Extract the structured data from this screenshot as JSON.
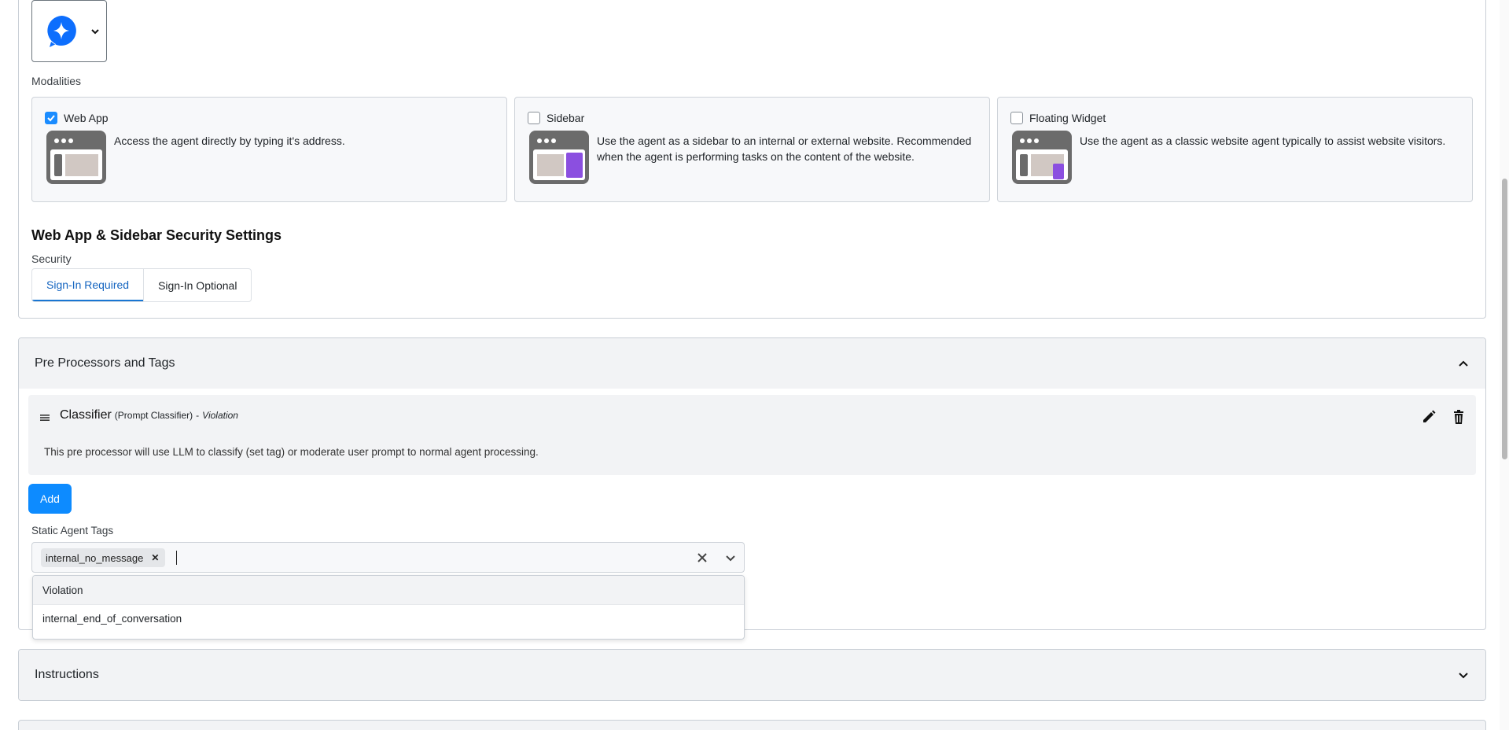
{
  "modalities": {
    "label": "Modalities",
    "cards": [
      {
        "label": "Web App",
        "checked": true,
        "description": "Access the agent directly by typing it's address."
      },
      {
        "label": "Sidebar",
        "checked": false,
        "description": "Use the agent as a sidebar to an internal or external website. Recommended when the agent is performing tasks on the content of the website."
      },
      {
        "label": "Floating Widget",
        "checked": false,
        "description": "Use the agent as a classic website agent typically to assist website visitors."
      }
    ]
  },
  "security": {
    "title": "Web App & Sidebar Security Settings",
    "label": "Security",
    "options": [
      "Sign-In Required",
      "Sign-In Optional"
    ],
    "selected": "Sign-In Required"
  },
  "pre_processors": {
    "title": "Pre Processors and Tags",
    "item": {
      "name": "Classifier",
      "type": "(Prompt Classifier)",
      "separator": "-",
      "tag": "Violation",
      "description": "This pre processor will use LLM to classify (set tag) or moderate user prompt to normal agent processing."
    },
    "add_label": "Add",
    "static_tags_label": "Static Agent Tags",
    "selected_tags": [
      "internal_no_message"
    ],
    "dropdown_options": [
      "Violation",
      "internal_end_of_conversation"
    ]
  },
  "instructions": {
    "title": "Instructions"
  },
  "colors": {
    "accent": "#0d8bff",
    "purple": "#8b4fe0",
    "card_bg": "#f7f8fa"
  },
  "icons": {
    "agent": "chat-sparkle-icon",
    "edit": "pencil-icon",
    "delete": "trash-icon",
    "drag": "drag-handle-icon"
  }
}
